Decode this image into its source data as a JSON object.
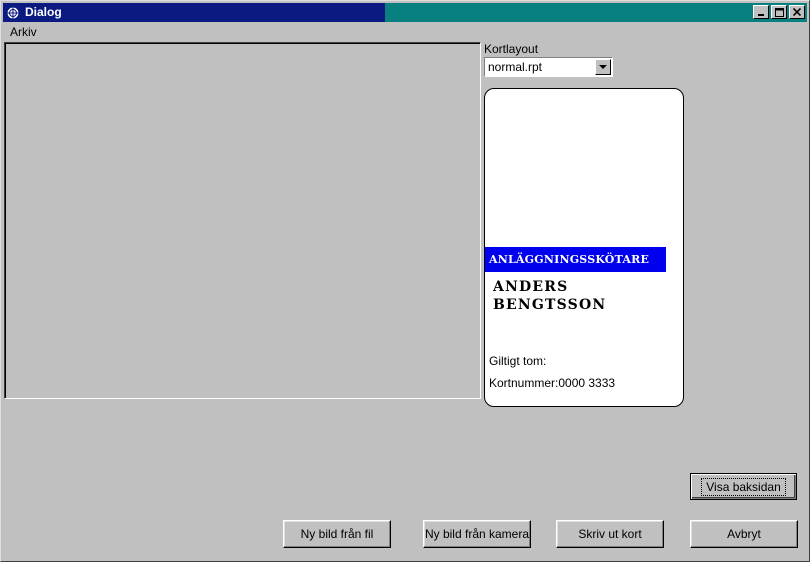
{
  "window": {
    "title": "Dialog",
    "controls": {
      "minimize": "_",
      "maximize": "□",
      "close": "✕"
    }
  },
  "menu": {
    "items": [
      "Arkiv"
    ]
  },
  "layout_select": {
    "label": "Kortlayout",
    "value": "normal.rpt"
  },
  "card": {
    "role": "ANLÄGGNINGSSKÖTARE",
    "name_line1": "ANDERS",
    "name_line2": "BENGTSSON",
    "valid_label": "Giltigt tom:",
    "card_number": "Kortnummer:0000 3333"
  },
  "buttons": {
    "show_back": "Visa baksidan",
    "new_from_file": "Ny bild från fil",
    "new_from_camera": "Ny bild från kamera",
    "print_card": "Skriv ut kort",
    "cancel": "Avbryt"
  },
  "colors": {
    "title_left": "#0a1a80",
    "title_right": "#088080",
    "role_band": "#0000ee",
    "face": "#c0c0c0"
  }
}
